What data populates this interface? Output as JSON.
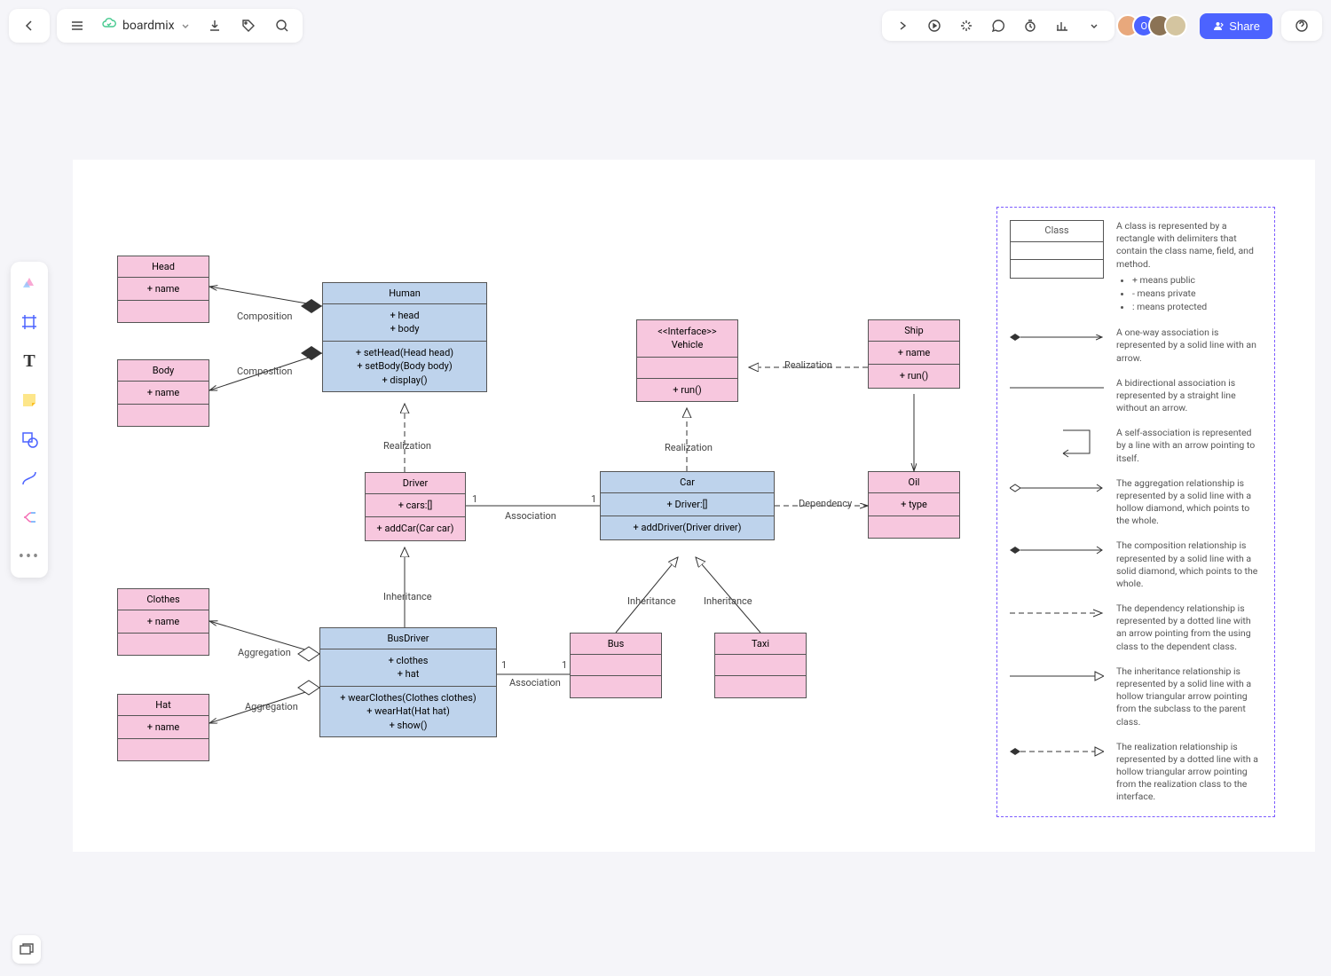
{
  "header": {
    "file_name": "boardmix",
    "share_label": "Share"
  },
  "classes": {
    "head": {
      "name": "Head",
      "attrs": [
        "+ name"
      ]
    },
    "body": {
      "name": "Body",
      "attrs": [
        "+ name"
      ]
    },
    "human": {
      "name": "Human",
      "attrs": [
        "+ head",
        "+ body"
      ],
      "methods": [
        "+ setHead(Head head)",
        "+ setBody(Body body)",
        "+ display()"
      ]
    },
    "driver": {
      "name": "Driver",
      "attrs": [
        "+ cars:[]"
      ],
      "methods": [
        "+ addCar(Car car)"
      ]
    },
    "busdriver": {
      "name": "BusDriver",
      "attrs": [
        "+ clothes",
        "+ hat"
      ],
      "methods": [
        "+ wearClothes(Clothes clothes)",
        "+ wearHat(Hat hat)",
        "+ show()"
      ]
    },
    "clothes": {
      "name": "Clothes",
      "attrs": [
        "+ name"
      ]
    },
    "hat": {
      "name": "Hat",
      "attrs": [
        "+ name"
      ]
    },
    "vehicle": {
      "stereotype": "<<Interface>>",
      "name": "Vehicle",
      "methods": [
        "+ run()"
      ]
    },
    "car": {
      "name": "Car",
      "attrs": [
        "+ Driver:[]"
      ],
      "methods": [
        "+ addDriver(Driver driver)"
      ]
    },
    "bus": {
      "name": "Bus"
    },
    "taxi": {
      "name": "Taxi"
    },
    "ship": {
      "name": "Ship",
      "attrs": [
        "+ name"
      ],
      "methods": [
        "+ run()"
      ]
    },
    "oil": {
      "name": "Oil",
      "attrs": [
        "+ type"
      ]
    }
  },
  "edges": {
    "comp1": "Composition",
    "comp2": "Composition",
    "real1": "Realization",
    "assoc1": "Association",
    "inh1": "Inheritance",
    "agg1": "Aggregation",
    "agg2": "Aggregation",
    "assoc2": "Association",
    "real2": "Realization",
    "real3": "Realization",
    "dep": "Dependency",
    "inh2": "Inheritance",
    "inh3": "Inheritance",
    "one": "1"
  },
  "legend": {
    "class_title": "Class",
    "class_desc": "A class is represented by a rectangle with delimiters that contain the class name, field, and method.",
    "bullets": [
      "+ means public",
      "- means private",
      ": means protected"
    ],
    "oneway": "A one-way association is represented by a solid line with an arrow.",
    "bidir": "A bidirectional association is represented by a straight line without an arrow.",
    "self": "A self-association is represented by a line with an arrow pointing to itself.",
    "aggregation": "The aggregation relationship is represented by a solid line with a hollow diamond, which points to the whole.",
    "composition": "The composition relationship is represented by a solid line with a solid diamond, which points to the whole.",
    "dependency": "The dependency relationship is represented by a dotted line with an arrow pointing from the using class to the dependent class.",
    "inheritance": "The inheritance relationship is represented by a solid line with a hollow triangular arrow pointing from the subclass to the parent class.",
    "realization": "The realization relationship is represented by a dotted line with a hollow triangular arrow pointing from the realization class to the interface."
  }
}
